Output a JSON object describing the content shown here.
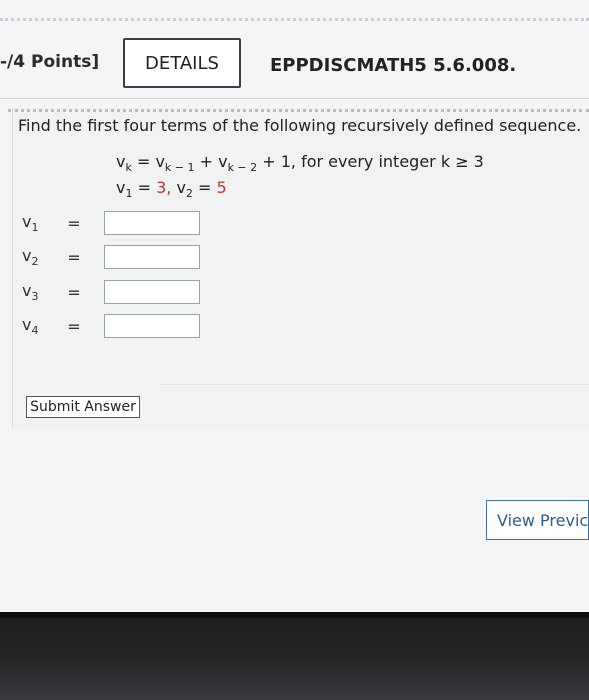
{
  "header": {
    "points_label": "-/4 Points]",
    "details_label": "DETAILS",
    "problem_code": "EPPDISCMATH5 5.6.008."
  },
  "question": {
    "prompt": "Find the first four terms of the following recursively defined sequence.",
    "recurrence": {
      "lhs": "v",
      "lhs_sub": "k",
      "eq": "=",
      "t1": "v",
      "t1_sub": "k − 1",
      "plus1": "+",
      "t2": "v",
      "t2_sub": "k − 2",
      "tail": "+ 1, for every integer k ≥ 3"
    },
    "initial": {
      "a": "v",
      "a_sub": "1",
      "a_eq": "=",
      "a_val": "3",
      "comma": ",",
      "b": "v",
      "b_sub": "2",
      "b_eq": "=",
      "b_val": "5"
    }
  },
  "answers": [
    {
      "var": "v",
      "sub": "1",
      "eq": "=",
      "value": ""
    },
    {
      "var": "v",
      "sub": "2",
      "eq": "=",
      "value": ""
    },
    {
      "var": "v",
      "sub": "3",
      "eq": "=",
      "value": ""
    },
    {
      "var": "v",
      "sub": "4",
      "eq": "=",
      "value": ""
    }
  ],
  "submit_label": "Submit Answer",
  "view_previous_label": "View Previc",
  "colors": {
    "accent_blue": "#2a5d92",
    "initial_value_red": "#c0392b"
  }
}
